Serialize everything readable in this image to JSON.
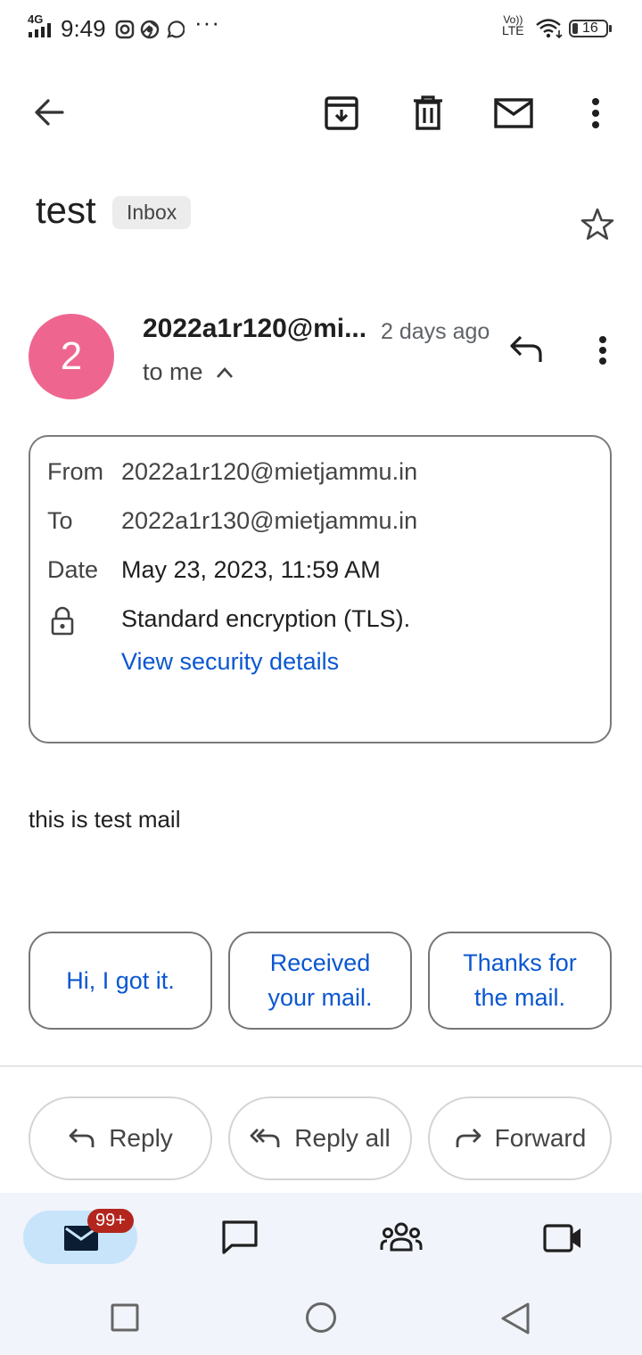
{
  "status_bar": {
    "network": "4G",
    "time": "9:49",
    "more": "···",
    "volte_top": "Vo))",
    "volte_bottom": "LTE",
    "battery": "16"
  },
  "email": {
    "subject": "test",
    "label_chip": "Inbox",
    "avatar_letter": "2",
    "sender_short": "2022a1r120@mi...",
    "time_ago": "2 days ago",
    "to_me": "to me",
    "details": {
      "from_label": "From",
      "from_value": "2022a1r120@mietjammu.in",
      "to_label": "To",
      "to_value": "2022a1r130@mietjammu.in",
      "date_label": "Date",
      "date_value": "May 23, 2023, 11:59 AM",
      "encryption": "Standard encryption (TLS).",
      "security_link": "View security details"
    },
    "body": "this is test mail"
  },
  "smart_replies": [
    {
      "line1": "Hi, I got it.",
      "line2": ""
    },
    {
      "line1": "Received",
      "line2": "your mail."
    },
    {
      "line1": "Thanks for",
      "line2": "the mail."
    }
  ],
  "actions": {
    "reply": "Reply",
    "reply_all": "Reply all",
    "forward": "Forward"
  },
  "bottom_nav": {
    "mail_badge": "99+"
  },
  "colors": {
    "accent": "#0b57d0",
    "avatar": "#ee6690",
    "badge": "#b3261e",
    "nav_pill": "#c7e4fb"
  }
}
